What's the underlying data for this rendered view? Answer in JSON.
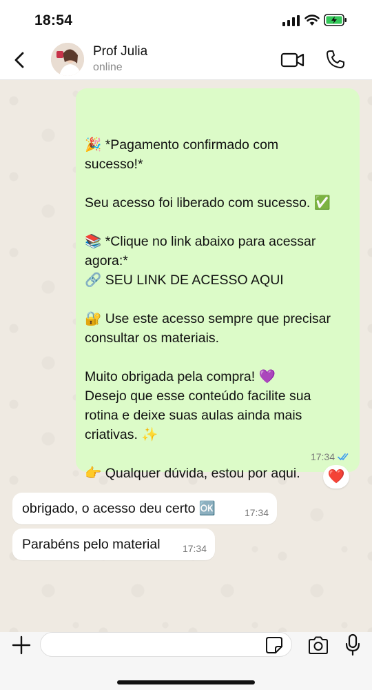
{
  "status_bar": {
    "time": "18:54"
  },
  "header": {
    "contact_name": "Prof Julia",
    "contact_status": "online"
  },
  "messages": [
    {
      "direction": "outgoing",
      "text": "🎉 *Pagamento confirmado com\nsucesso!*\n\nSeu acesso foi liberado com sucesso. ✅\n\n📚 *Clique no link abaixo para acessar\nagora:*\n🔗 SEU LINK DE ACESSO AQUI\n\n🔐 Use este acesso sempre que precisar\nconsultar os materiais.\n\nMuito obrigada pela compra! 💜\nDesejo que esse conteúdo facilite sua\nrotina e deixe suas aulas ainda mais\ncriativas. ✨\n\n👉 Qualquer dúvida, estou por aqui.",
      "time": "17:34",
      "reaction": "❤️"
    },
    {
      "direction": "incoming",
      "text": "obrigado, o acesso deu certo 🆗",
      "time": "17:34"
    },
    {
      "direction": "incoming",
      "text": "Parabéns pelo material",
      "time": "17:34"
    }
  ],
  "input": {
    "placeholder": ""
  },
  "colors": {
    "outgoing_bubble": "#dcfbc8",
    "incoming_bubble": "#ffffff",
    "read_ticks": "#3b9cf0"
  },
  "icons": [
    "signal-icon",
    "wifi-icon",
    "battery-icon",
    "back-icon",
    "video-call-icon",
    "phone-icon",
    "plus-icon",
    "sticker-icon",
    "camera-icon",
    "microphone-icon",
    "read-ticks-icon"
  ]
}
